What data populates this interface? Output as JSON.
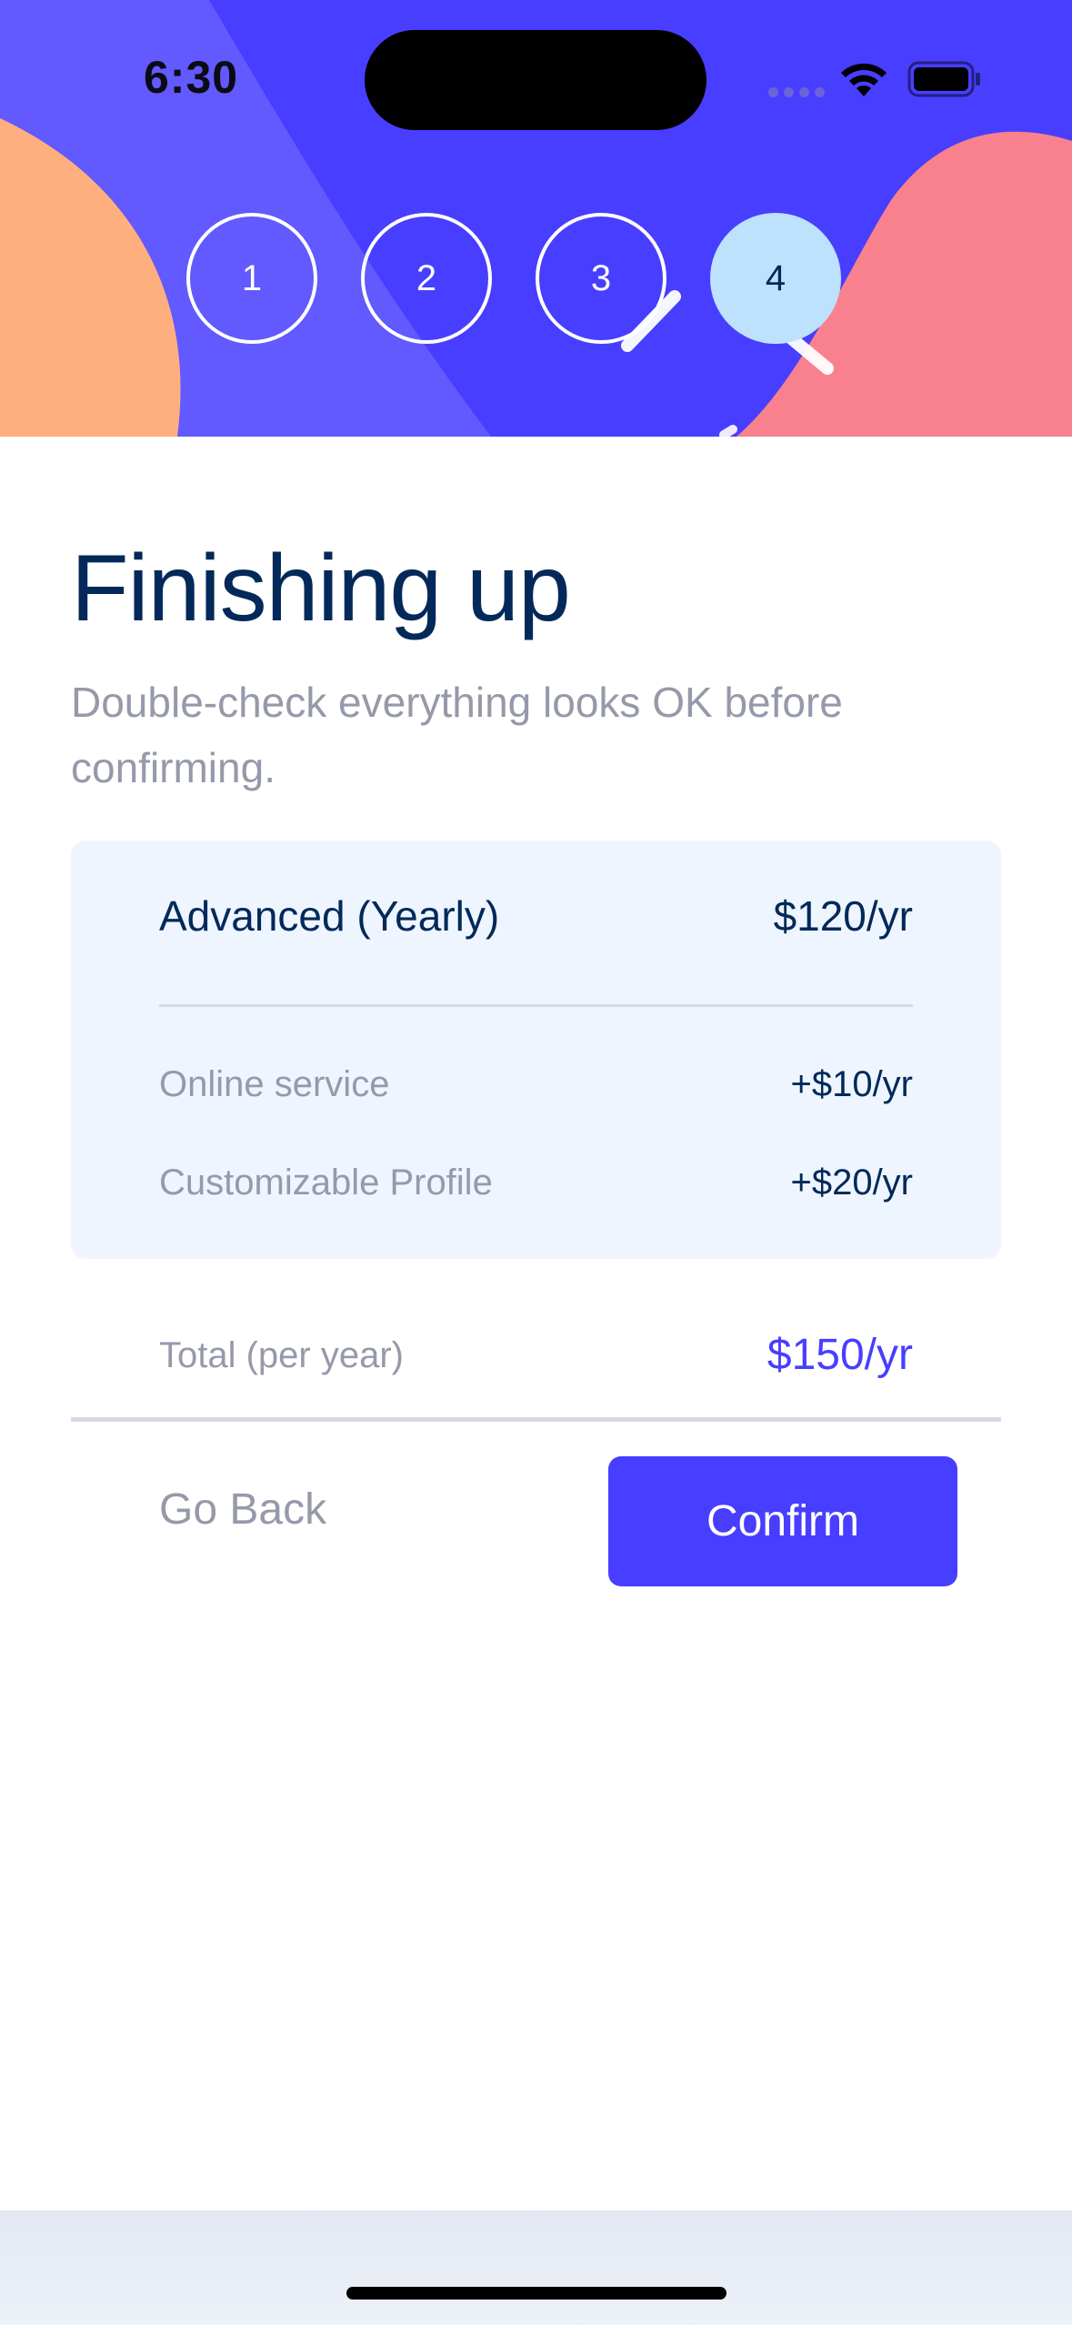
{
  "status_bar": {
    "time": "6:30",
    "icons": [
      "cellular-signal-icon",
      "wifi-icon",
      "battery-icon"
    ]
  },
  "steps": [
    {
      "number": "1",
      "active": false
    },
    {
      "number": "2",
      "active": false
    },
    {
      "number": "3",
      "active": false
    },
    {
      "number": "4",
      "active": true
    }
  ],
  "page": {
    "title": "Finishing up",
    "subtitle": "Double-check everything looks OK before confirming."
  },
  "summary": {
    "plan_name": "Advanced (Yearly)",
    "plan_price": "$120/yr",
    "addons": [
      {
        "name": "Online service",
        "price": "+$10/yr"
      },
      {
        "name": "Customizable Profile",
        "price": "+$20/yr"
      }
    ]
  },
  "total": {
    "label": "Total (per year)",
    "price": "$150/yr"
  },
  "actions": {
    "back_label": "Go Back",
    "confirm_label": "Confirm"
  },
  "colors": {
    "accent": "#483eff",
    "primary_text": "#022959",
    "muted_text": "#9699aa",
    "summary_bg": "#eef5ff",
    "active_step": "#bee2fd",
    "banner_orange": "#ffaf7e",
    "banner_pink": "#f9818e"
  }
}
